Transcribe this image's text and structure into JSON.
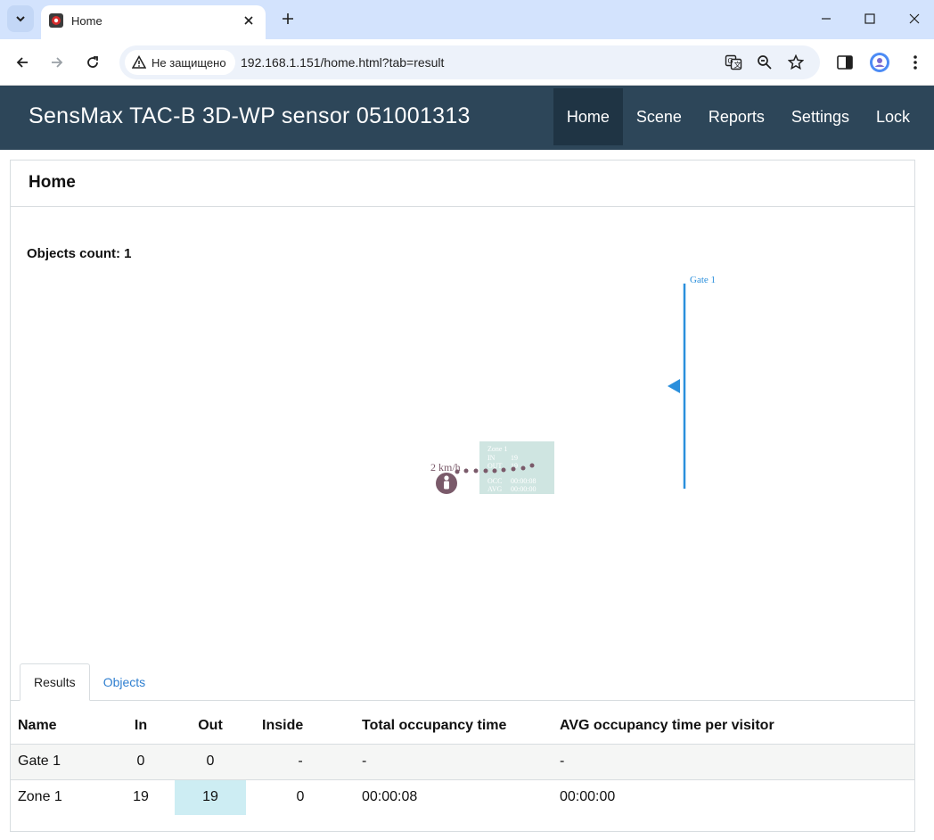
{
  "browser": {
    "tab_title": "Home",
    "security_label": "Не защищено",
    "url": "192.168.1.151/home.html?tab=result"
  },
  "app": {
    "title": "SensMax TAC-B 3D-WP sensor 051001313",
    "nav": [
      {
        "label": "Home",
        "active": true
      },
      {
        "label": "Scene",
        "active": false
      },
      {
        "label": "Reports",
        "active": false
      },
      {
        "label": "Settings",
        "active": false
      },
      {
        "label": "Lock",
        "active": false
      }
    ]
  },
  "page": {
    "title": "Home",
    "objects_count_label": "Objects count: 1"
  },
  "scene": {
    "gate_label": "Gate 1",
    "speed_label": "2 km/h",
    "zone_tooltip": {
      "name": "Zone 1",
      "in_label": "IN",
      "in_value": "19",
      "out_label": "OUT",
      "out_value": "19",
      "occ_label": "OCC",
      "occ_value": "00:00:08",
      "avg_label": "AVG",
      "avg_value": "00:00:00"
    },
    "colors": {
      "gate": "#2a8fdc",
      "track": "#7a5a6a",
      "zone": "#cfe5e1"
    }
  },
  "tabs": {
    "results": "Results",
    "objects": "Objects"
  },
  "table": {
    "headers": [
      "Name",
      "In",
      "Out",
      "Inside",
      "Total occupancy time",
      "AVG occupancy time per visitor"
    ],
    "rows": [
      [
        "Gate 1",
        "0",
        "0",
        "-",
        "-",
        "-"
      ],
      [
        "Zone 1",
        "19",
        "19",
        "0",
        "00:00:08",
        "00:00:00"
      ]
    ]
  }
}
